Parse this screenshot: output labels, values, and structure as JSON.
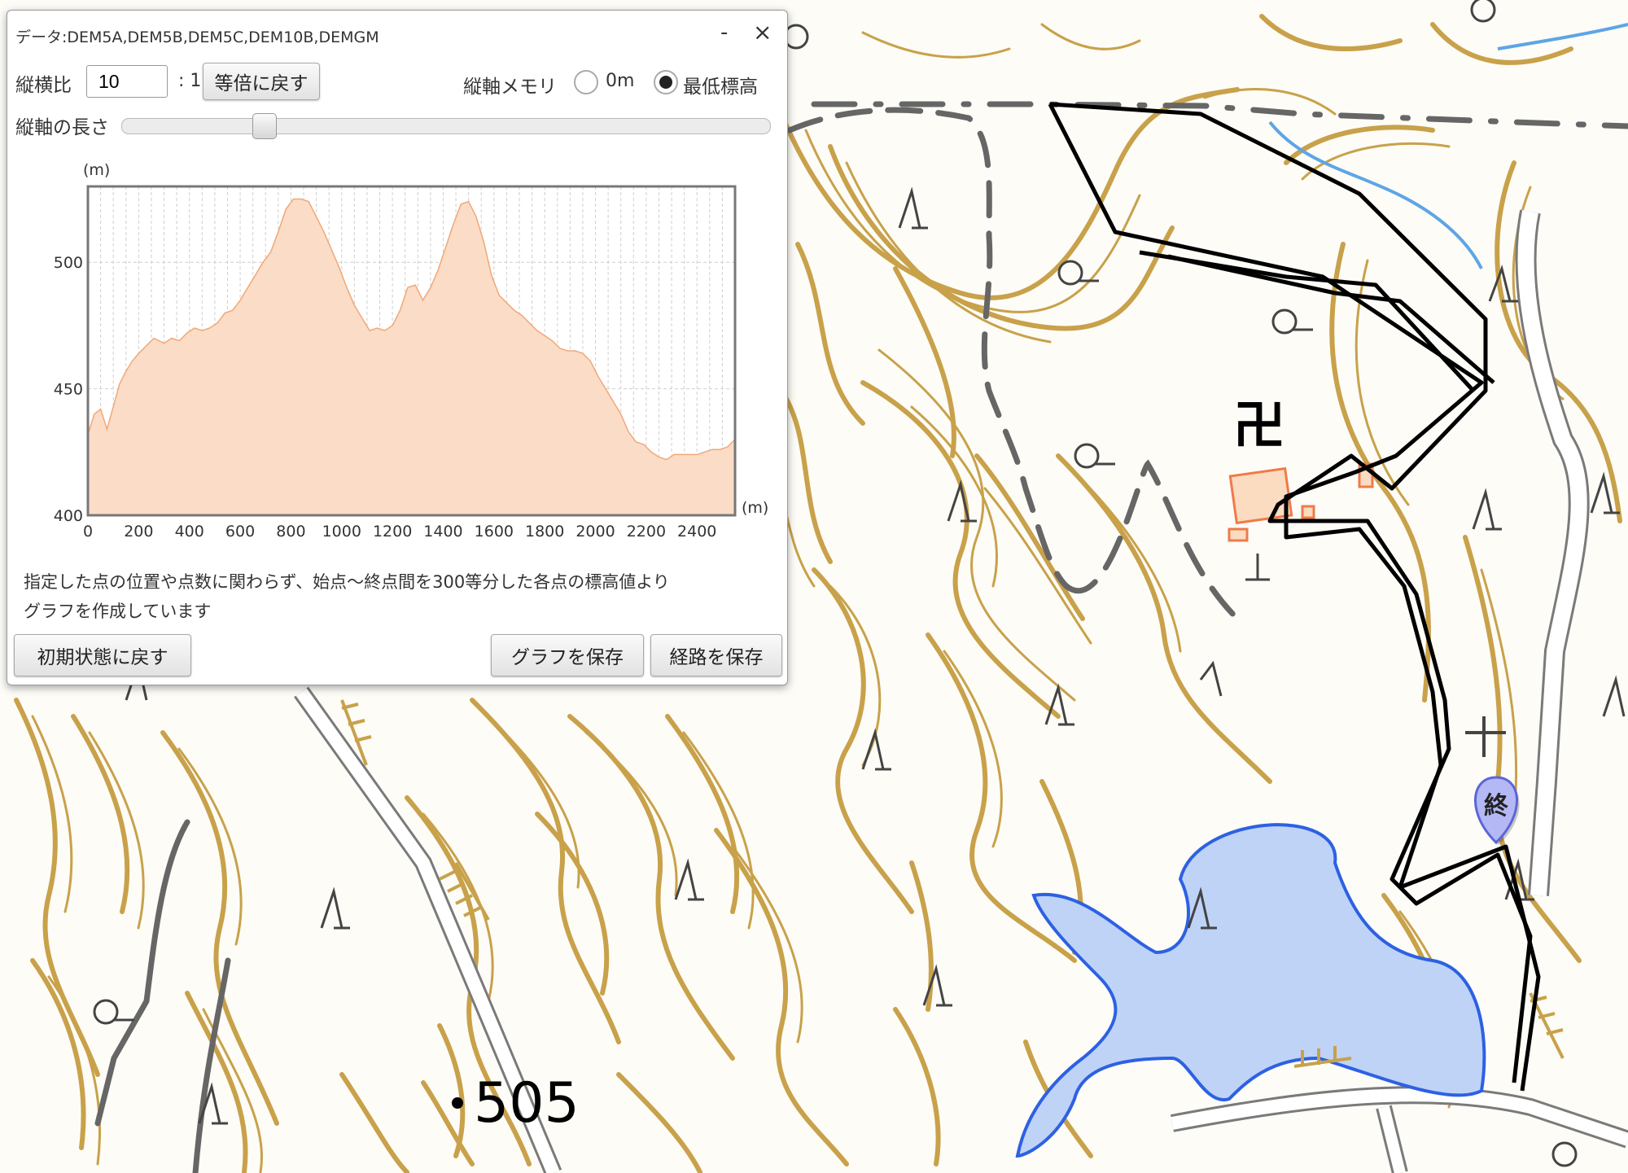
{
  "panel": {
    "title": "データ:DEM5A,DEM5B,DEM5C,DEM10B,DEMGM",
    "minimize_label": "-",
    "close_label": "×",
    "ratio_label": "縦横比",
    "ratio_value": "10",
    "ratio_suffix": ": 1",
    "reset_ratio_button": "等倍に戻す",
    "axis_memory_label": "縦軸メモリ",
    "radio_zero_label": "0m",
    "radio_min_label": "最低標高",
    "radio_selected": "最低標高",
    "axis_length_label": "縦軸の長さ",
    "axis_length_slider": 0.21,
    "note_line1": "指定した点の位置や点数に関わらず、始点～終点間を300等分した各点の標高値より",
    "note_line2": "グラフを作成しています",
    "reset_button": "初期状態に戻す",
    "save_graph_button": "グラフを保存",
    "save_route_button": "経路を保存"
  },
  "chart_data": {
    "type": "area",
    "ylabel": "(m)",
    "xlabel": "(m)",
    "xlim": [
      0,
      2550
    ],
    "ylim": [
      400,
      530
    ],
    "yticks": [
      400,
      450,
      500
    ],
    "xticks": [
      0,
      200,
      400,
      600,
      800,
      1000,
      1200,
      1400,
      1600,
      1800,
      2000,
      2200,
      2400
    ],
    "grid": true,
    "fill_color": "#fbdcc6",
    "line_color": "#f0a878",
    "x": [
      0,
      25,
      50,
      75,
      100,
      125,
      150,
      175,
      200,
      230,
      260,
      300,
      330,
      360,
      390,
      420,
      450,
      480,
      510,
      540,
      570,
      600,
      630,
      660,
      690,
      720,
      750,
      780,
      810,
      840,
      870,
      900,
      930,
      960,
      990,
      1020,
      1050,
      1080,
      1110,
      1140,
      1170,
      1200,
      1230,
      1260,
      1290,
      1320,
      1350,
      1380,
      1410,
      1440,
      1470,
      1500,
      1530,
      1560,
      1590,
      1620,
      1650,
      1680,
      1710,
      1740,
      1770,
      1800,
      1830,
      1860,
      1890,
      1920,
      1950,
      1980,
      2010,
      2040,
      2070,
      2100,
      2130,
      2160,
      2190,
      2220,
      2250,
      2280,
      2310,
      2340,
      2370,
      2400,
      2430,
      2460,
      2490,
      2520,
      2550
    ],
    "y": [
      432,
      440,
      442,
      434,
      443,
      452,
      457,
      461,
      464,
      467,
      470,
      468,
      470,
      469,
      472,
      474,
      473,
      474,
      476,
      480,
      481,
      485,
      490,
      495,
      500,
      504,
      512,
      521,
      525,
      525,
      524,
      518,
      512,
      505,
      498,
      490,
      483,
      478,
      473,
      474,
      473,
      475,
      481,
      490,
      491,
      485,
      490,
      497,
      506,
      515,
      523,
      524,
      518,
      508,
      495,
      487,
      484,
      481,
      479,
      476,
      473,
      471,
      469,
      466,
      465,
      465,
      464,
      461,
      455,
      450,
      445,
      440,
      433,
      429,
      428,
      425,
      423,
      422,
      424,
      424,
      424,
      424,
      425,
      426,
      426,
      427,
      430
    ]
  },
  "map": {
    "elevation_label": "505",
    "end_marker_label": "終",
    "temple_symbol": "卍"
  }
}
